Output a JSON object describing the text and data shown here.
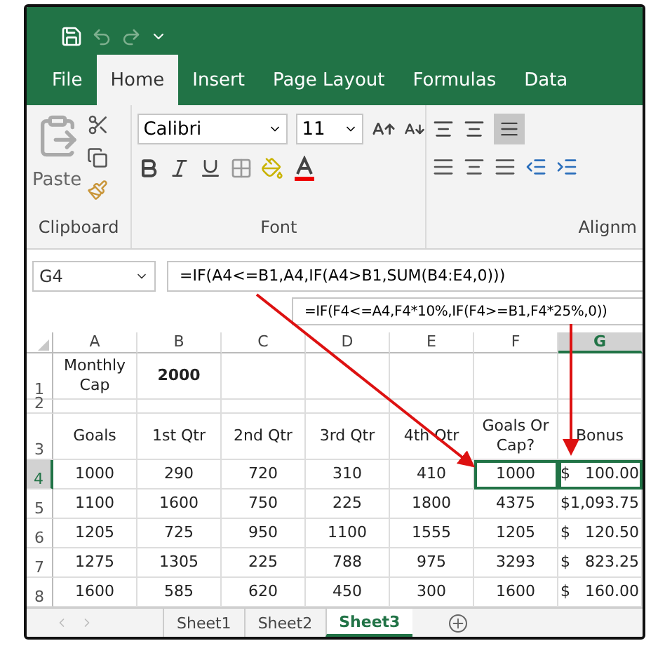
{
  "ribbon_tabs": [
    {
      "label": "File",
      "selected": false
    },
    {
      "label": "Home",
      "selected": true
    },
    {
      "label": "Insert",
      "selected": false
    },
    {
      "label": "Page Layout",
      "selected": false
    },
    {
      "label": "Formulas",
      "selected": false
    },
    {
      "label": "Data",
      "selected": false
    }
  ],
  "ribbon": {
    "paste_label": "Paste",
    "clipboard_label": "Clipboard",
    "font_name": "Calibri",
    "font_size": "11",
    "font_label": "Font",
    "alignment_label": "Alignm"
  },
  "formula_bar": {
    "name_box": "G4",
    "formula": "=IF(A4<=B1,A4,IF(A4>B1,SUM(B4:E4,0)))"
  },
  "callout_formula": "=IF(F4<=A4,F4*10%,IF(F4>=B1,F4*25%,0))",
  "columns": [
    {
      "label": "A",
      "selected": false
    },
    {
      "label": "B",
      "selected": false
    },
    {
      "label": "C",
      "selected": false
    },
    {
      "label": "D",
      "selected": false
    },
    {
      "label": "E",
      "selected": false
    },
    {
      "label": "F",
      "selected": false
    },
    {
      "label": "G",
      "selected": true
    }
  ],
  "rows": [
    {
      "header": "1",
      "selected": false,
      "kind": "tall",
      "cells": [
        {
          "text": "Monthly Cap",
          "selected": false
        },
        {
          "text": "2000",
          "selected": false,
          "bold": true
        },
        {
          "selected": false
        },
        {
          "selected": false
        },
        {
          "selected": false
        },
        {
          "selected": false
        },
        {
          "selected": false
        }
      ]
    },
    {
      "header": "2",
      "selected": false,
      "kind": "thin",
      "cells": [
        {
          "selected": false
        },
        {
          "selected": false
        },
        {
          "selected": false
        },
        {
          "selected": false
        },
        {
          "selected": false
        },
        {
          "selected": false
        },
        {
          "selected": false
        }
      ]
    },
    {
      "header": "3",
      "selected": false,
      "kind": "tall",
      "cells": [
        {
          "text": "Goals",
          "selected": false
        },
        {
          "text": "1st Qtr",
          "selected": false
        },
        {
          "text": "2nd Qtr",
          "selected": false
        },
        {
          "text": "3rd Qtr",
          "selected": false
        },
        {
          "text": "4th Qtr",
          "selected": false
        },
        {
          "text": "Goals Or Cap?",
          "selected": false
        },
        {
          "text": "Bonus",
          "selected": false
        }
      ]
    },
    {
      "header": "4",
      "selected": true,
      "kind": "normal",
      "cells": [
        {
          "text": "1000",
          "selected": false
        },
        {
          "text": "290",
          "selected": false
        },
        {
          "text": "720",
          "selected": false
        },
        {
          "text": "310",
          "selected": false
        },
        {
          "text": "410",
          "selected": false
        },
        {
          "text": "1000",
          "selected": true
        },
        {
          "text": "$   100.00",
          "selected": true
        }
      ]
    },
    {
      "header": "5",
      "selected": false,
      "kind": "normal",
      "cells": [
        {
          "text": "1100",
          "selected": false
        },
        {
          "text": "1600",
          "selected": false
        },
        {
          "text": "750",
          "selected": false
        },
        {
          "text": "225",
          "selected": false
        },
        {
          "text": "1800",
          "selected": false
        },
        {
          "text": "4375",
          "selected": false
        },
        {
          "text": "$1,093.75",
          "selected": false
        }
      ]
    },
    {
      "header": "6",
      "selected": false,
      "kind": "normal",
      "cells": [
        {
          "text": "1205",
          "selected": false
        },
        {
          "text": "725",
          "selected": false
        },
        {
          "text": "950",
          "selected": false
        },
        {
          "text": "1100",
          "selected": false
        },
        {
          "text": "1555",
          "selected": false
        },
        {
          "text": "1205",
          "selected": false
        },
        {
          "text": "$   120.50",
          "selected": false
        }
      ]
    },
    {
      "header": "7",
      "selected": false,
      "kind": "normal",
      "cells": [
        {
          "text": "1275",
          "selected": false
        },
        {
          "text": "1305",
          "selected": false
        },
        {
          "text": "225",
          "selected": false
        },
        {
          "text": "788",
          "selected": false
        },
        {
          "text": "975",
          "selected": false
        },
        {
          "text": "3293",
          "selected": false
        },
        {
          "text": "$   823.25",
          "selected": false
        }
      ]
    },
    {
      "header": "8",
      "selected": false,
      "kind": "normal",
      "cells": [
        {
          "text": "1600",
          "selected": false
        },
        {
          "text": "585",
          "selected": false
        },
        {
          "text": "620",
          "selected": false
        },
        {
          "text": "450",
          "selected": false
        },
        {
          "text": "300",
          "selected": false
        },
        {
          "text": "1600",
          "selected": false
        },
        {
          "text": "$   160.00",
          "selected": false
        }
      ]
    }
  ],
  "sheet_tabs": [
    {
      "label": "Sheet1",
      "selected": false
    },
    {
      "label": "Sheet2",
      "selected": false
    },
    {
      "label": "Sheet3",
      "selected": true
    }
  ]
}
